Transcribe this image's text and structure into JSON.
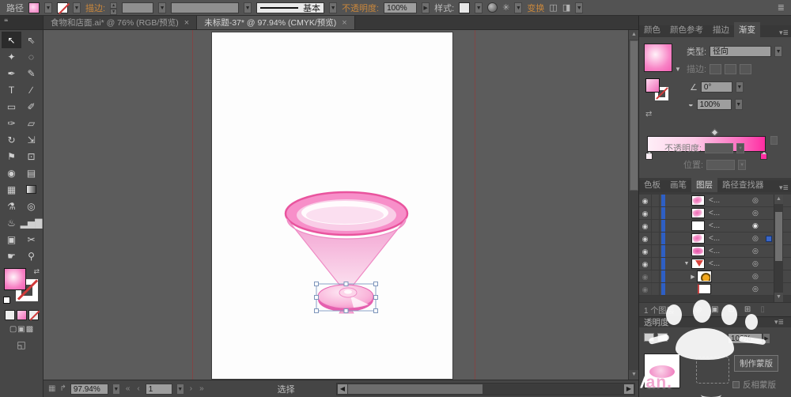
{
  "control_bar": {
    "context_label": "路径",
    "stroke_label": "描边:",
    "brush_definition": "基本",
    "opacity_label": "不透明度:",
    "opacity_value": "100%",
    "style_label": "样式:",
    "transform_label": "变换",
    "icons": {
      "select_similar": "✳",
      "align": "◫",
      "distribute": "◨",
      "panel_menu": "≣"
    }
  },
  "document_tabs": [
    {
      "title": "食物和店面.ai* @ 76% (RGB/预览)",
      "close": "×",
      "active": false
    },
    {
      "title": "未标题-37* @ 97.94% (CMYK/预览)",
      "close": "×",
      "active": true
    }
  ],
  "toolbar": {
    "collapse_icon": "❝",
    "tools": [
      {
        "name": "selection-tool",
        "glyph": "↖",
        "active": true
      },
      {
        "name": "direct-selection-tool",
        "glyph": "⇖"
      },
      {
        "name": "magic-wand-tool",
        "glyph": "✦"
      },
      {
        "name": "lasso-tool",
        "glyph": "◌"
      },
      {
        "name": "pen-tool",
        "glyph": "✒"
      },
      {
        "name": "pencil-tool",
        "glyph": "✎"
      },
      {
        "name": "type-tool",
        "glyph": "T"
      },
      {
        "name": "line-segment-tool",
        "glyph": "∕"
      },
      {
        "name": "rectangle-tool",
        "glyph": "▭"
      },
      {
        "name": "paintbrush-tool",
        "glyph": "✐"
      },
      {
        "name": "blob-brush-tool",
        "glyph": "✑"
      },
      {
        "name": "eraser-tool",
        "glyph": "▱"
      },
      {
        "name": "rotate-tool",
        "glyph": "↻"
      },
      {
        "name": "scale-tool",
        "glyph": "⇲"
      },
      {
        "name": "width-tool",
        "glyph": "⚑"
      },
      {
        "name": "free-transform-tool",
        "glyph": "⊡"
      },
      {
        "name": "shape-builder-tool",
        "glyph": "◉"
      },
      {
        "name": "perspective-grid-tool",
        "glyph": "▤"
      },
      {
        "name": "mesh-tool",
        "glyph": "▦"
      },
      {
        "name": "gradient-tool",
        "glyph": ""
      },
      {
        "name": "eyedropper-tool",
        "glyph": "⚗"
      },
      {
        "name": "blend-tool",
        "glyph": "◎"
      },
      {
        "name": "symbol-sprayer-tool",
        "glyph": "♨"
      },
      {
        "name": "column-graph-tool",
        "glyph": "▂▅▇"
      },
      {
        "name": "artboard-tool",
        "glyph": "▣"
      },
      {
        "name": "slice-tool",
        "glyph": "✂"
      },
      {
        "name": "hand-tool",
        "glyph": "☛"
      },
      {
        "name": "zoom-tool",
        "glyph": "⚲"
      }
    ],
    "mode_buttons": [
      "▢",
      "▣",
      "▩"
    ],
    "screen_mode_icon": "◱"
  },
  "gradient_panel": {
    "tabs": [
      {
        "label": "颜色",
        "active": false
      },
      {
        "label": "颜色参考",
        "active": false
      },
      {
        "label": "描边",
        "active": false
      },
      {
        "label": "渐变",
        "active": true
      }
    ],
    "panel_menu_icon": "▾≣",
    "type_label": "类型:",
    "type_value": "径向",
    "stroke_label": "描边:",
    "angle_icon": "∠",
    "angle_value": "0°",
    "aspect_icon": "◒",
    "aspect_value": "100%",
    "opacity_label": "不透明度:",
    "location_label": "位置:",
    "reverse_icon": "⇄",
    "gradient_css": "linear-gradient(90deg,#feeef7 0%,#fdc9e6 40%,#fb71c1 78%,#ff2da2 100%)"
  },
  "layers_panel": {
    "tabs": [
      {
        "label": "色板",
        "active": false
      },
      {
        "label": "画笔",
        "active": false
      },
      {
        "label": "图层",
        "active": true
      },
      {
        "label": "路径查找器",
        "active": false
      }
    ],
    "panel_menu_icon": "▾≣",
    "eye_icon": "◉",
    "target_icon": "◎",
    "target_icon_filled": "◉",
    "rows": [
      {
        "label": "<...",
        "thumb": "petal",
        "eye": "on",
        "expand": "",
        "indent": false,
        "selected": false,
        "target": "normal"
      },
      {
        "label": "<...",
        "thumb": "petal",
        "eye": "on",
        "expand": "",
        "indent": false,
        "selected": false,
        "target": "normal"
      },
      {
        "label": "<...",
        "thumb": "white",
        "eye": "on",
        "expand": "",
        "indent": false,
        "selected": false,
        "target": "filled"
      },
      {
        "label": "<...",
        "thumb": "petal",
        "eye": "on",
        "expand": "",
        "indent": false,
        "selected": true,
        "target": "normal"
      },
      {
        "label": "<...",
        "thumb": "petal-dark",
        "eye": "on",
        "expand": "",
        "indent": false,
        "selected": false,
        "target": "normal"
      },
      {
        "label": "<...",
        "thumb": "glass",
        "eye": "on",
        "expand": "▼",
        "indent": false,
        "selected": false,
        "target": "normal"
      },
      {
        "label": "",
        "thumb": "orange",
        "eye": "dim",
        "expand": "▶",
        "indent": true,
        "selected": false,
        "target": "normal"
      },
      {
        "label": "",
        "thumb": "plain",
        "eye": "dim",
        "expand": "",
        "indent": true,
        "selected": false,
        "target": "normal"
      }
    ],
    "footer": {
      "count_text": "1 个图层",
      "icons": [
        {
          "name": "locate-object-icon",
          "glyph": "◎",
          "dim": false
        },
        {
          "name": "clipping-mask-icon",
          "glyph": "▣",
          "dim": false
        },
        {
          "name": "new-sublayer-icon",
          "glyph": "⊟",
          "dim": false
        },
        {
          "name": "new-layer-icon",
          "glyph": "⊞",
          "dim": false
        },
        {
          "name": "delete-layer-icon",
          "glyph": "▯",
          "dim": true
        }
      ]
    }
  },
  "transparency_panel": {
    "title": "透明度",
    "panel_menu_icon": "▾≣",
    "opacity_value": "100%",
    "make_mask_label": "制作蒙版",
    "invert_mask_label": "反相蒙版"
  },
  "status_bar": {
    "icon_left_1": "▦",
    "icon_left_2": "↱",
    "zoom_value": "97.94%",
    "nav_first": "«",
    "nav_prev": "‹",
    "artboard_value": "1",
    "nav_next": "›",
    "nav_last": "»",
    "status_text": "选择"
  },
  "watermark": {
    "slash": "/",
    "text": "an."
  },
  "artwork": {
    "description": "pink martini cocktail glass, base ellipse selected with bounding box",
    "rim_color": "#f78fc9",
    "rim_stroke": "#e9549e",
    "liquid_color": "#f9cde7",
    "base_color": "#f4a3d3",
    "selection_color": "#8aa2c6"
  }
}
